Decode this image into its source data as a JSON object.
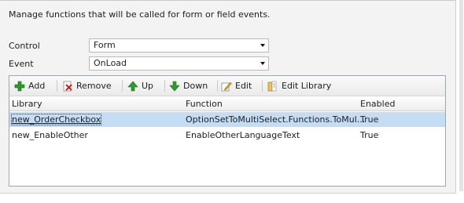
{
  "description": "Manage functions that will be called for form or field events.",
  "control": {
    "label": "Control",
    "value": "Form"
  },
  "event": {
    "label": "Event",
    "value": "OnLoad"
  },
  "toolbar": {
    "add": "Add",
    "remove": "Remove",
    "up": "Up",
    "down": "Down",
    "edit": "Edit",
    "edit_library": "Edit Library"
  },
  "columns": [
    "Library",
    "Function",
    "Enabled"
  ],
  "rows": [
    {
      "library": "new_OrderCheckbox",
      "function": "OptionSetToMultiSelect.Functions.ToMul...",
      "enabled": "True",
      "selected": true
    },
    {
      "library": "new_EnableOther",
      "function": "EnableOtherLanguageText",
      "enabled": "True",
      "selected": false
    }
  ],
  "colors": {
    "selected_row": "#c5dcf5",
    "panel_bg": "#f3f3f3"
  }
}
